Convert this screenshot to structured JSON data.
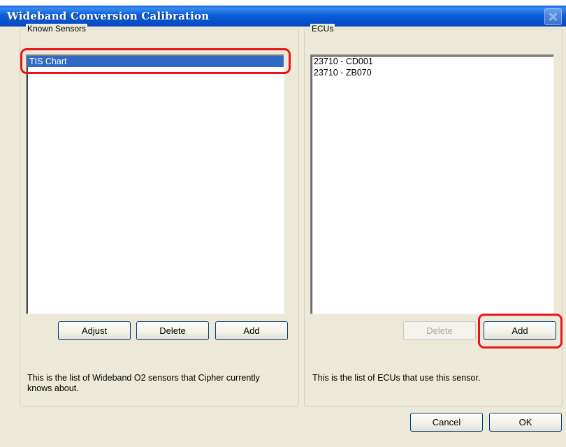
{
  "window": {
    "title": "Wideband Conversion Calibration"
  },
  "known_sensors": {
    "label": "Known Sensors",
    "items": [
      "TIS Chart"
    ],
    "buttons": {
      "adjust": "Adjust",
      "delete": "Delete",
      "add": "Add"
    },
    "description": "This is the list of Wideband O2 sensors that Cipher currently knows about."
  },
  "ecus": {
    "label": "ECUs",
    "items": [
      "23710 - CD001",
      "23710 - ZB070"
    ],
    "buttons": {
      "delete": "Delete",
      "add": "Add"
    },
    "description": "This is the list of ECUs that use this sensor."
  },
  "footer": {
    "cancel": "Cancel",
    "ok": "OK"
  },
  "colors": {
    "titlebar": "#0553d1",
    "selection": "#316ac5",
    "highlight": "#e8141c",
    "dialog_bg": "#ece9d8"
  }
}
